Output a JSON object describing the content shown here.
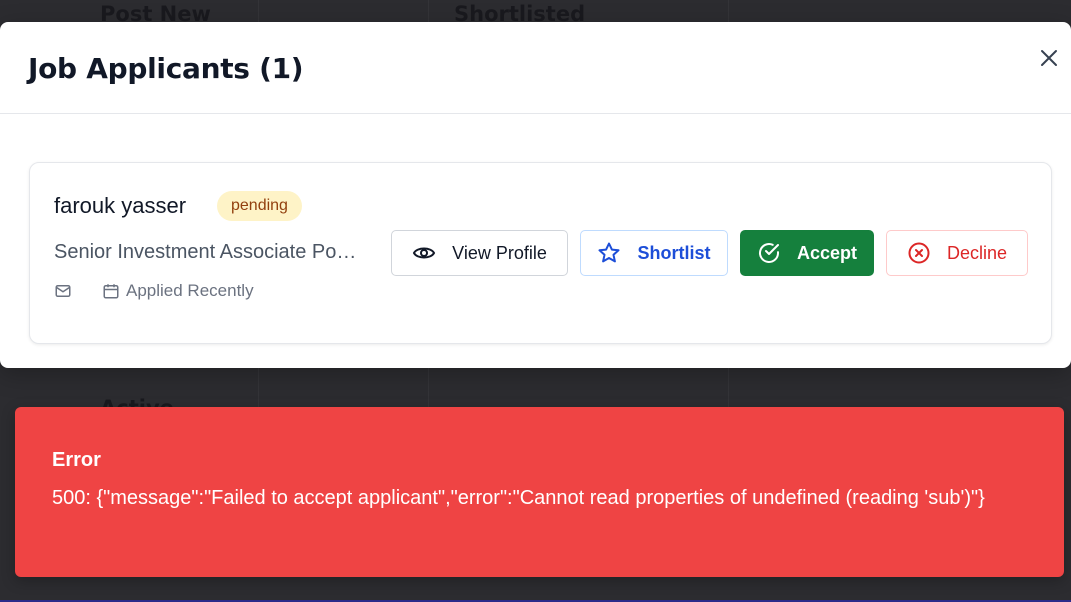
{
  "background": {
    "row1_col1": "Post New",
    "row1_col2": "Shortlisted",
    "row2_col1": "Active"
  },
  "modal": {
    "title": "Job Applicants (1)",
    "close_icon": "close-icon"
  },
  "applicant": {
    "name": "farouk yasser",
    "status": "pending",
    "job_title": "Senior Investment Associate Position",
    "applied": "Applied Recently",
    "actions": {
      "view_profile": "View Profile",
      "shortlist": "Shortlist",
      "accept": "Accept",
      "decline": "Decline"
    }
  },
  "toast": {
    "title": "Error",
    "message": "500: {\"message\":\"Failed to accept applicant\",\"error\":\"Cannot read properties of undefined (reading 'sub')\"}"
  },
  "colors": {
    "accept": "#15803d",
    "decline": "#dc2626",
    "shortlist": "#1d4ed8",
    "badge_bg": "#fef3c7",
    "badge_text": "#92400e",
    "toast_bg": "#ef4444"
  }
}
